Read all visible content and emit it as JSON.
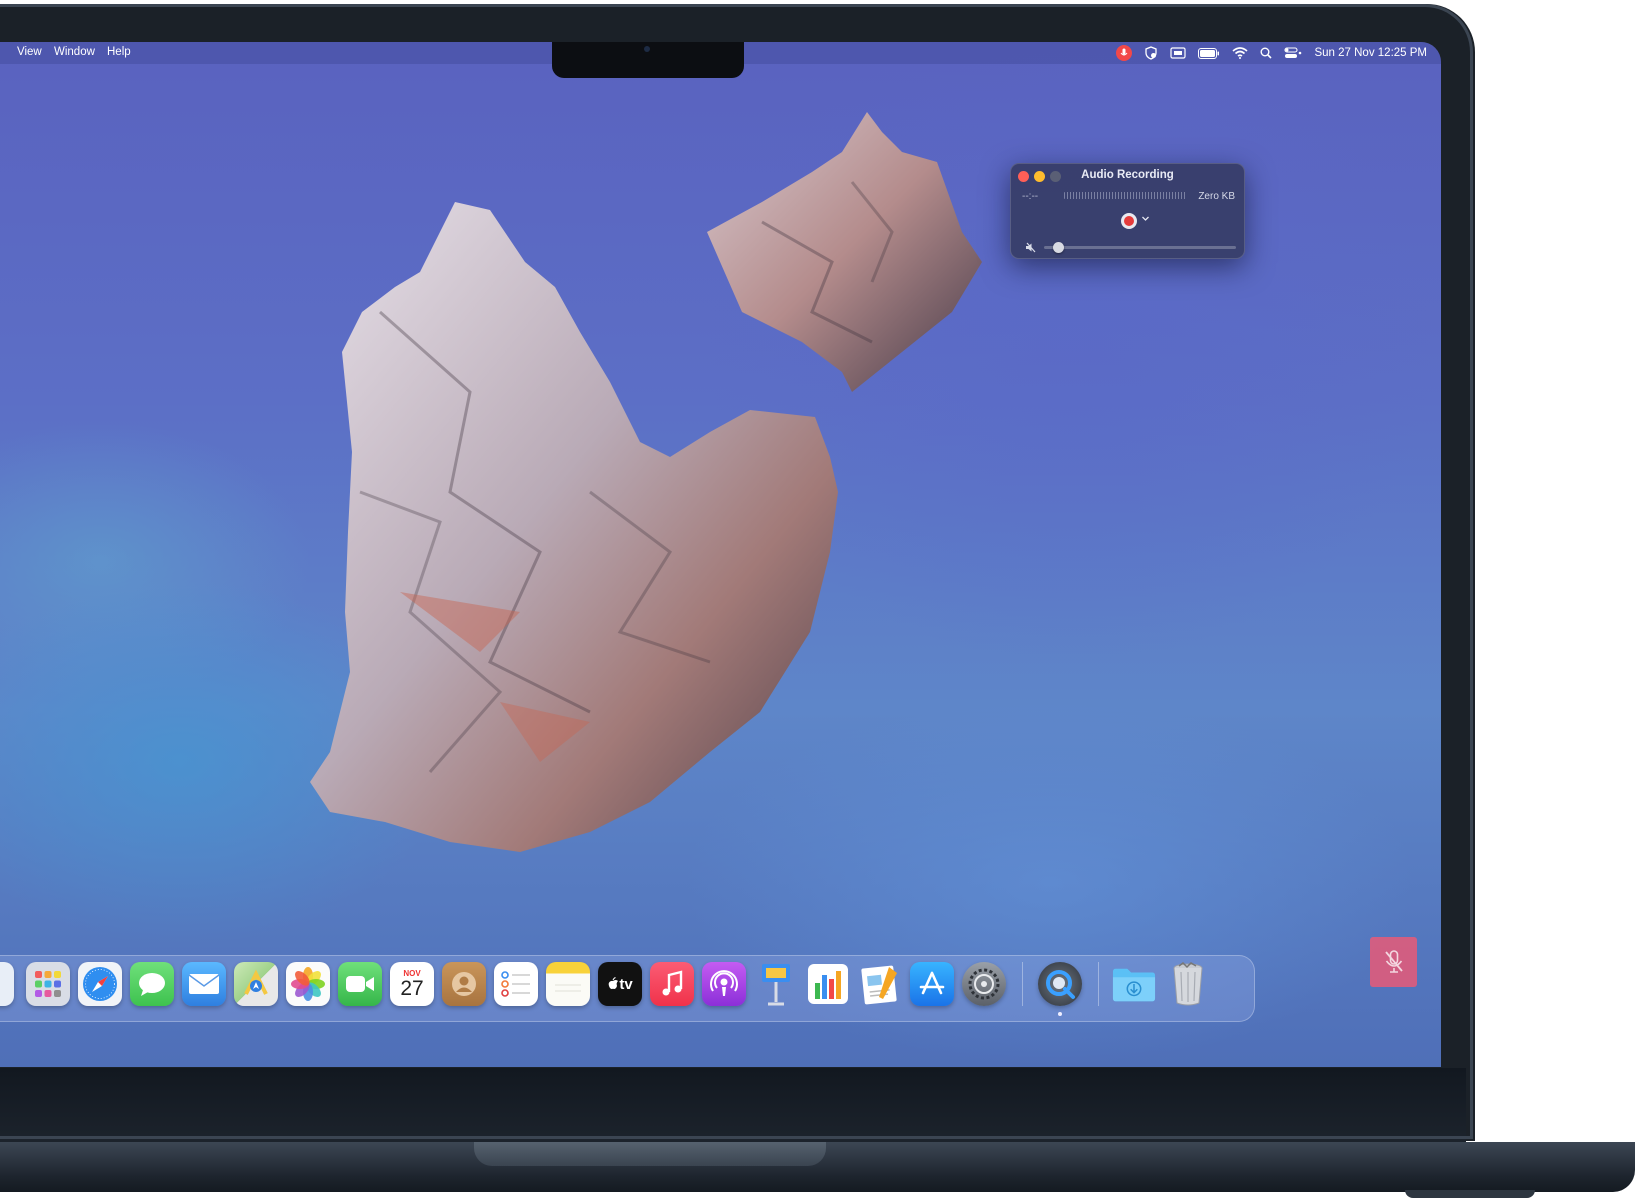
{
  "menubar": {
    "items": [
      "View",
      "Window",
      "Help"
    ],
    "clock": "Sun 27 Nov  12:25 PM"
  },
  "audio_window": {
    "title": "Audio Recording",
    "time": "--:--",
    "size": "Zero KB",
    "volume": 0.05
  },
  "dock": {
    "calendar_month": "NOV",
    "calendar_day": "27",
    "tv_label": "tv",
    "apps": [
      "finder",
      "launchpad",
      "safari",
      "messages",
      "mail",
      "maps",
      "photos",
      "facetime",
      "calendar",
      "contacts",
      "reminders",
      "notes",
      "apple-tv",
      "music",
      "podcasts",
      "keynote",
      "numbers",
      "pages",
      "app-store",
      "system-settings",
      "quicktime-player",
      "downloads",
      "trash"
    ]
  },
  "colors": {
    "record_red": "#e53b3b",
    "mic_indicator": "#f24848",
    "mute_overlay": "#e85a78"
  }
}
